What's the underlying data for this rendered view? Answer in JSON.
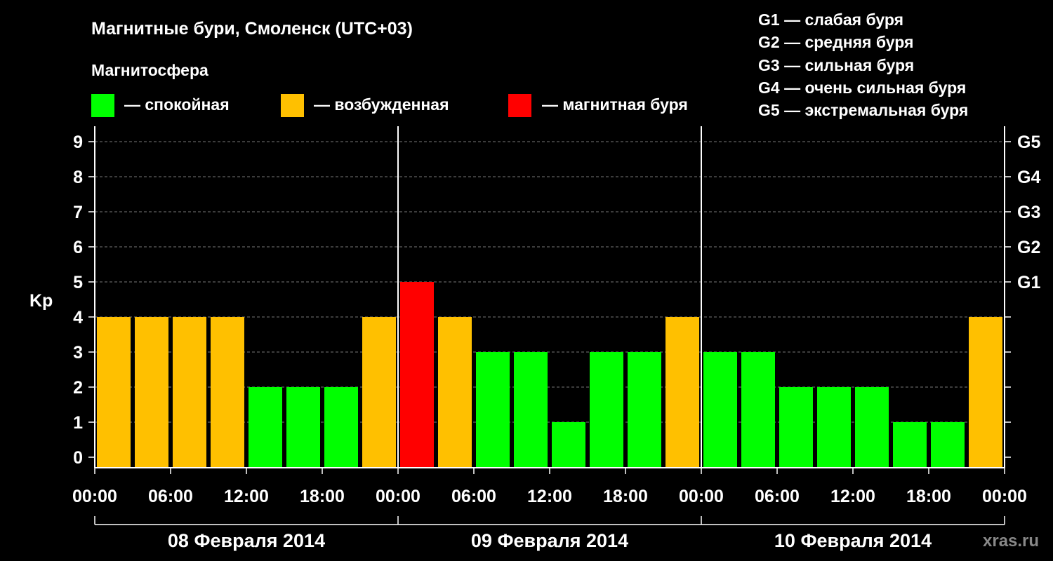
{
  "chart_data": {
    "type": "bar",
    "title": "Магнитные бури, Смоленск (UTC+03)",
    "subtitle": "Магнитосфера",
    "ylabel": "Kp",
    "ylim": [
      0,
      9
    ],
    "yticks": [
      "0",
      "1",
      "2",
      "3",
      "4",
      "5",
      "6",
      "7",
      "8",
      "9"
    ],
    "right_ticks": [
      {
        "kp": 5,
        "label": "G1"
      },
      {
        "kp": 6,
        "label": "G2"
      },
      {
        "kp": 7,
        "label": "G3"
      },
      {
        "kp": 8,
        "label": "G4"
      },
      {
        "kp": 9,
        "label": "G5"
      }
    ],
    "xticks": [
      "00:00",
      "06:00",
      "12:00",
      "18:00",
      "00:00",
      "06:00",
      "12:00",
      "18:00",
      "00:00",
      "06:00",
      "12:00",
      "18:00",
      "00:00"
    ],
    "days": [
      "08 Февраля 2014",
      "09 Февраля 2014",
      "10 Февраля 2014"
    ],
    "interval_hours": 3,
    "values": [
      4,
      4,
      4,
      4,
      2,
      2,
      2,
      4,
      5,
      4,
      3,
      3,
      1,
      3,
      3,
      4,
      3,
      3,
      2,
      2,
      2,
      1,
      1,
      4
    ],
    "grid": "dashed horizontal",
    "legend": [
      {
        "label": "— спокойная",
        "color": "#00ff00"
      },
      {
        "label": "— возбужденная",
        "color": "#ffc000"
      },
      {
        "label": "— магнитная буря",
        "color": "#ff0000"
      }
    ],
    "storm_scale": [
      "G1 — слабая буря",
      "G2 — средняя буря",
      "G3 — сильная буря",
      "G4 — очень сильная буря",
      "G5 — экстремальная буря"
    ],
    "colors": {
      "calm": "#00ff00",
      "active": "#ffc000",
      "storm": "#ff0000"
    }
  },
  "watermark": "xras.ru"
}
